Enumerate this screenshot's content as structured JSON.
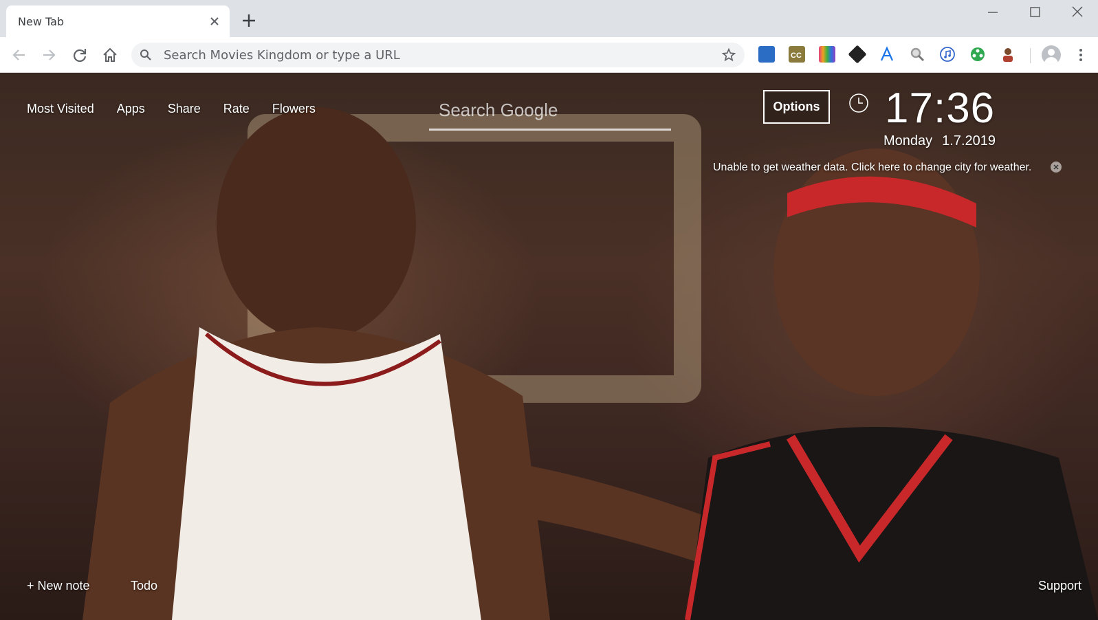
{
  "browser": {
    "tab": {
      "title": "New Tab"
    },
    "omnibox": {
      "placeholder": "Search Movies Kingdom or type a URL"
    },
    "extensions": [
      {
        "icon": "blue-tile-extension-icon",
        "color": "#2b6cc4"
      },
      {
        "icon": "cc-extension-icon",
        "color": "#8a7a3c"
      },
      {
        "icon": "rainbow-stripes-extension-icon",
        "color": "#e04080"
      },
      {
        "icon": "black-cube-extension-icon",
        "color": "#222222"
      },
      {
        "icon": "letter-a-extension-icon",
        "color": "#1a73e8"
      },
      {
        "icon": "magnifier-extension-icon",
        "color": "#999999"
      },
      {
        "icon": "music-note-extension-icon",
        "color": "#3366cc"
      },
      {
        "icon": "green-film-extension-icon",
        "color": "#2fa84f"
      },
      {
        "icon": "player-avatar-extension-icon",
        "color": "#b04030"
      }
    ]
  },
  "page": {
    "nav_links": [
      "Most Visited",
      "Apps",
      "Share",
      "Rate",
      "Flowers"
    ],
    "search_placeholder": "Search Google",
    "options_label": "Options",
    "clock": {
      "time": "17:36",
      "weekday": "Monday",
      "date": "1.7.2019"
    },
    "weather_message": "Unable to get weather data. Click here to change city for weather.",
    "bottom": {
      "new_note": "+ New note",
      "todo": "Todo",
      "support": "Support"
    }
  }
}
